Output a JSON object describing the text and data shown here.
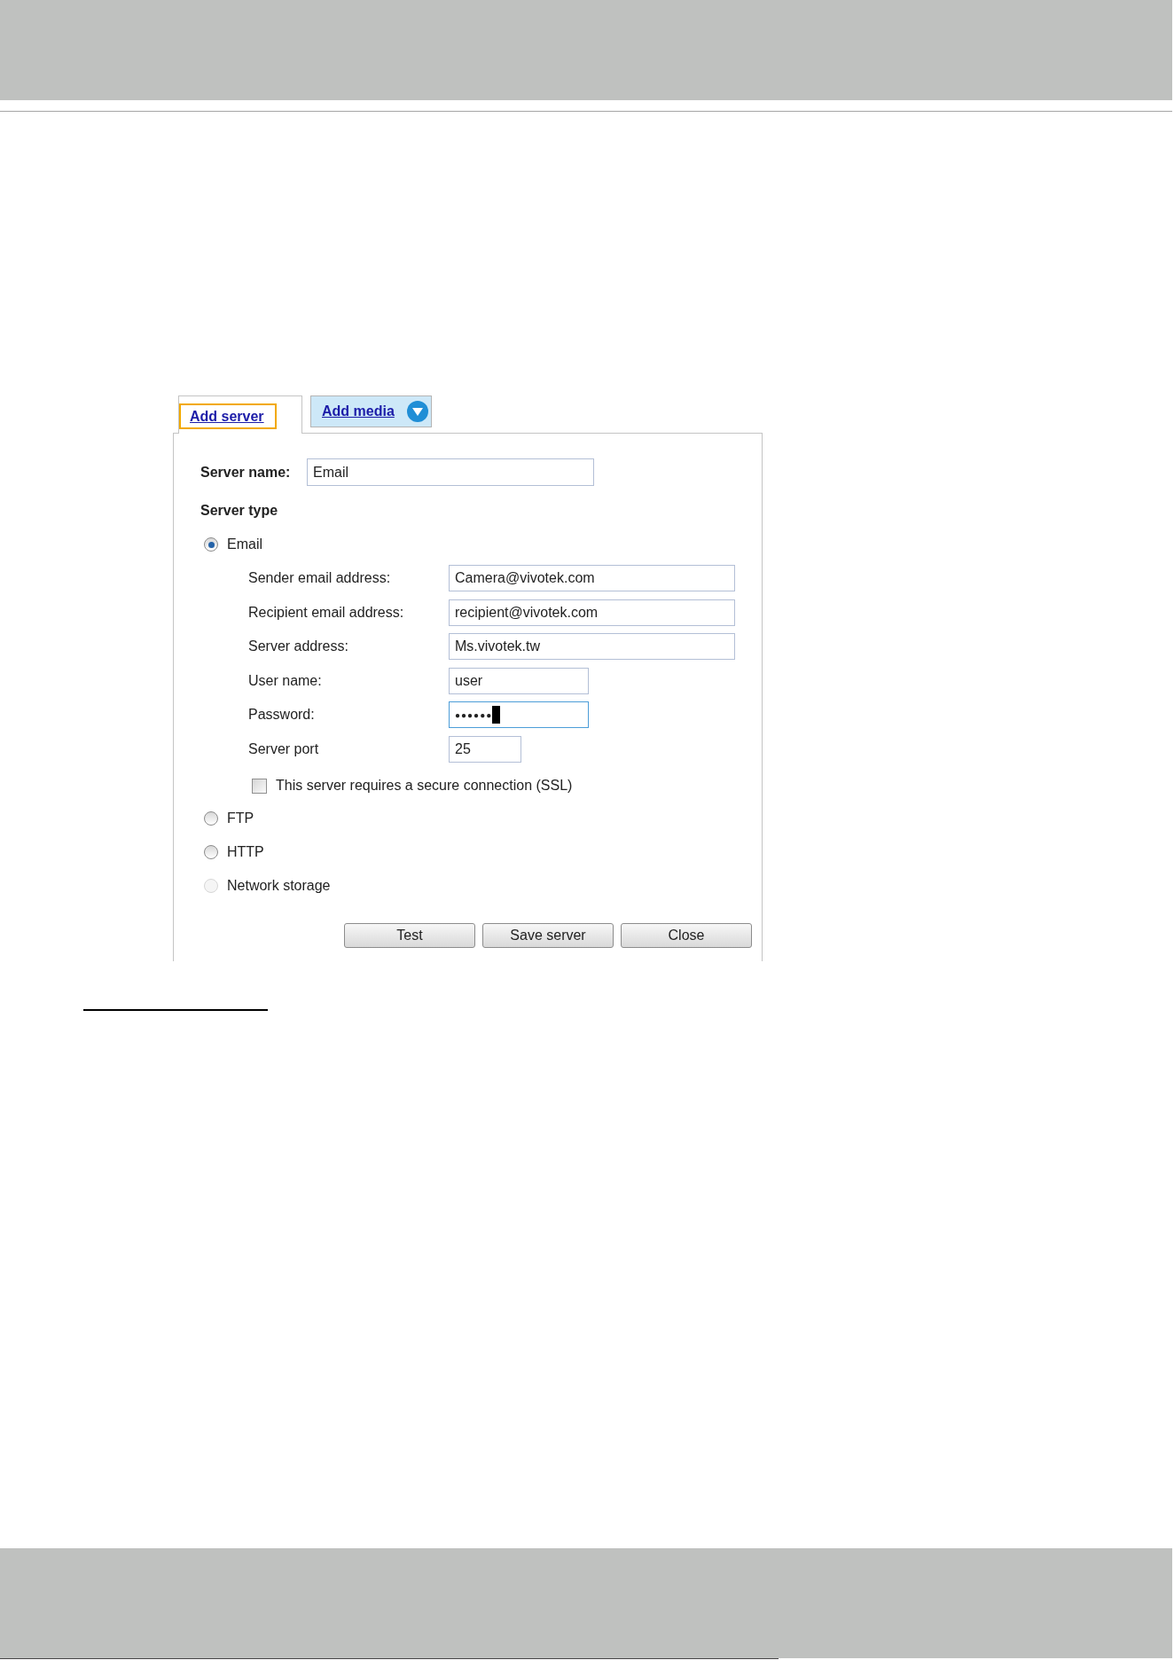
{
  "tabs": [
    {
      "label": "Add server",
      "selected": true,
      "focused": true,
      "dropdown": false
    },
    {
      "label": "Add media",
      "selected": false,
      "focused": false,
      "dropdown": true
    }
  ],
  "server_name": {
    "label": "Server name:",
    "value": "Email"
  },
  "server_type": {
    "heading": "Server type",
    "options": [
      {
        "label": "Email",
        "selected": true,
        "disabled": false,
        "settings": {
          "fields": [
            {
              "label": "Sender email address:",
              "value": "Camera@vivotek.com",
              "kind": "address",
              "focused": false
            },
            {
              "label": "Recipient email address:",
              "value": "recipient@vivotek.com",
              "kind": "address",
              "focused": false
            },
            {
              "label": "Server address:",
              "value": "Ms.vivotek.tw",
              "kind": "address",
              "focused": false
            },
            {
              "label": "User name:",
              "value": "user",
              "kind": "name",
              "focused": false
            },
            {
              "label": "Password:",
              "value": "●●●●●●",
              "kind": "password",
              "focused": true
            },
            {
              "label": "Server port",
              "value": "25",
              "kind": "port",
              "focused": false
            }
          ],
          "ssl": {
            "label": "This server requires a secure connection (SSL)",
            "checked": false
          }
        }
      },
      {
        "label": "FTP",
        "selected": false,
        "disabled": false
      },
      {
        "label": "HTTP",
        "selected": false,
        "disabled": false
      },
      {
        "label": "Network storage",
        "selected": false,
        "disabled": true
      }
    ]
  },
  "buttons": [
    "Test",
    "Save server",
    "Close"
  ]
}
